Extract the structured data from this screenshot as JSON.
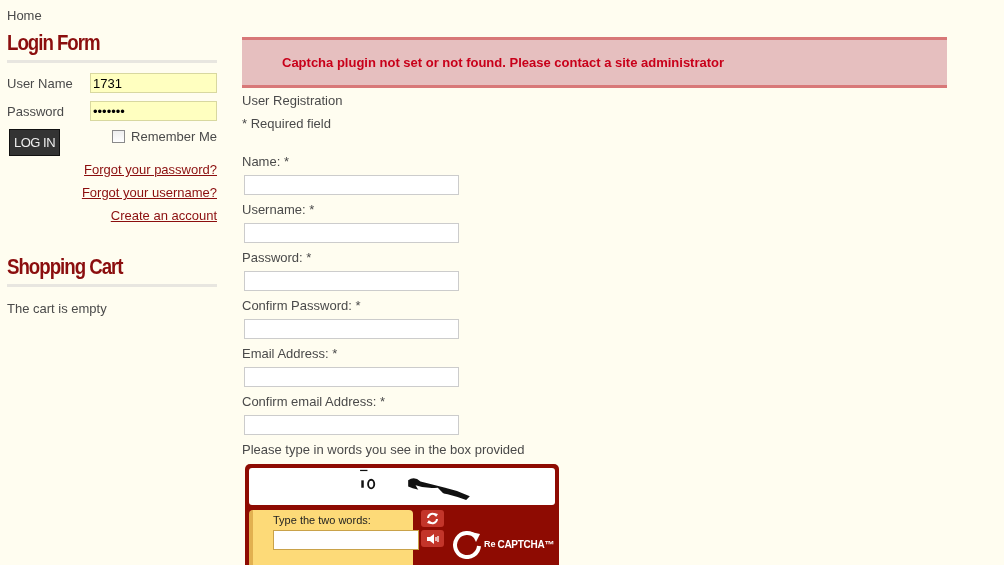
{
  "breadcrumb": "Home",
  "login_form": {
    "title": "Login Form",
    "fields": [
      {
        "label": "User Name",
        "value": "1731"
      },
      {
        "label": "Password",
        "value": "•••••••"
      }
    ],
    "login_button": "LOG IN",
    "remember_me": {
      "label": "Remember Me",
      "checked": false
    },
    "links": [
      "Forgot your password?",
      "Forgot your username?",
      "Create an account"
    ]
  },
  "shopping_cart": {
    "title": "Shopping Cart",
    "text": "The cart is empty"
  },
  "alert": {
    "message": "Captcha plugin not set or not found. Please contact a site administrator"
  },
  "registration": {
    "title": "User Registration",
    "required_note": "* Required field",
    "fields": [
      {
        "label": "Name: *"
      },
      {
        "label": "Username: *"
      },
      {
        "label": "Password: *"
      },
      {
        "label": "Confirm Password: *"
      },
      {
        "label": "Email Address: *"
      },
      {
        "label": "Confirm email Address: *"
      }
    ],
    "captcha_prompt": "Please type in words you see in the box provided"
  },
  "captcha": {
    "input_label": "Type the two words:",
    "logo_prefix": "Re",
    "logo": "CAPTCHA™"
  }
}
